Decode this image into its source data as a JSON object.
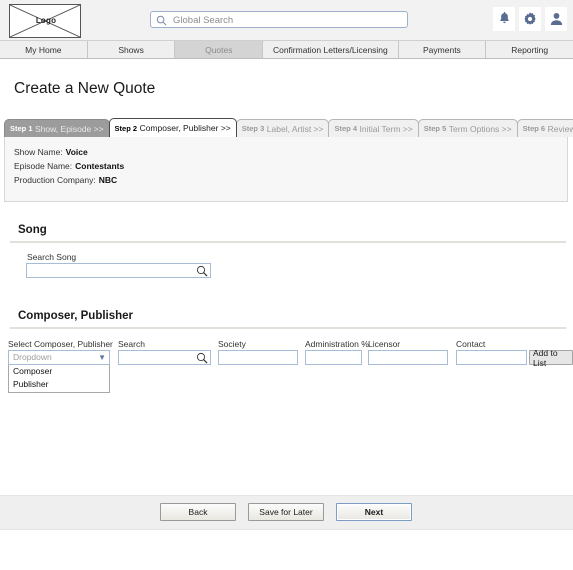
{
  "header": {
    "logo_label": "Logo",
    "search_placeholder": "Global Search",
    "search_value": "",
    "icons": {
      "search": "search-icon",
      "bell": "bell-icon",
      "gear": "gear-icon",
      "user": "user-icon"
    }
  },
  "nav": {
    "tabs": [
      {
        "label": "My Home",
        "active": false
      },
      {
        "label": "Shows",
        "active": false
      },
      {
        "label": "Quotes",
        "active": true
      },
      {
        "label": "Confirmation Letters/Licensing",
        "active": false
      },
      {
        "label": "Payments",
        "active": false
      },
      {
        "label": "Reporting",
        "active": false
      }
    ]
  },
  "page": {
    "title": "Create a New Quote"
  },
  "wizard": {
    "steps": [
      {
        "num": "Step 1",
        "label": "Show, Episode >>",
        "state": "done"
      },
      {
        "num": "Step 2",
        "label": "Composer, Publisher >>",
        "state": "current"
      },
      {
        "num": "Step 3",
        "label": "Label, Artist >>",
        "state": "upcoming"
      },
      {
        "num": "Step 4",
        "label": "Initial Term >>",
        "state": "upcoming"
      },
      {
        "num": "Step 5",
        "label": "Term Options >>",
        "state": "upcoming"
      },
      {
        "num": "Step 6",
        "label": "Review Quote",
        "state": "upcoming"
      }
    ],
    "info": [
      {
        "label": "Show Name:",
        "value": "Voice"
      },
      {
        "label": "Episode Name:",
        "value": "Contestants"
      },
      {
        "label": "Production Company:",
        "value": "NBC"
      }
    ]
  },
  "song_section": {
    "heading": "Song",
    "search_label": "Search Song",
    "search_value": "",
    "search_icon": "magnifier-icon"
  },
  "composer_section": {
    "heading": "Composer, Publisher",
    "select_label": "Select Composer, Publisher",
    "dropdown_value": "Dropdown",
    "dropdown_options": [
      "Composer",
      "Publisher"
    ],
    "fields": [
      {
        "label": "Search",
        "value": "",
        "has_search_icon": true
      },
      {
        "label": "Society",
        "value": "",
        "has_search_icon": false
      },
      {
        "label": "Administration %",
        "value": "",
        "has_search_icon": false
      },
      {
        "label": "Licensor",
        "value": "",
        "has_search_icon": false
      },
      {
        "label": "Contact",
        "value": "",
        "has_search_icon": false
      }
    ],
    "add_button": "Add to List"
  },
  "footer": {
    "back": "Back",
    "save_later": "Save for Later",
    "next": "Next"
  },
  "colors": {
    "icon_blue": "#5a6c91",
    "active_tab": "#d4d4d4",
    "step_done": "#9c9c9c",
    "field_border": "#a8bcd8",
    "primary_border": "#7a9cc6"
  }
}
